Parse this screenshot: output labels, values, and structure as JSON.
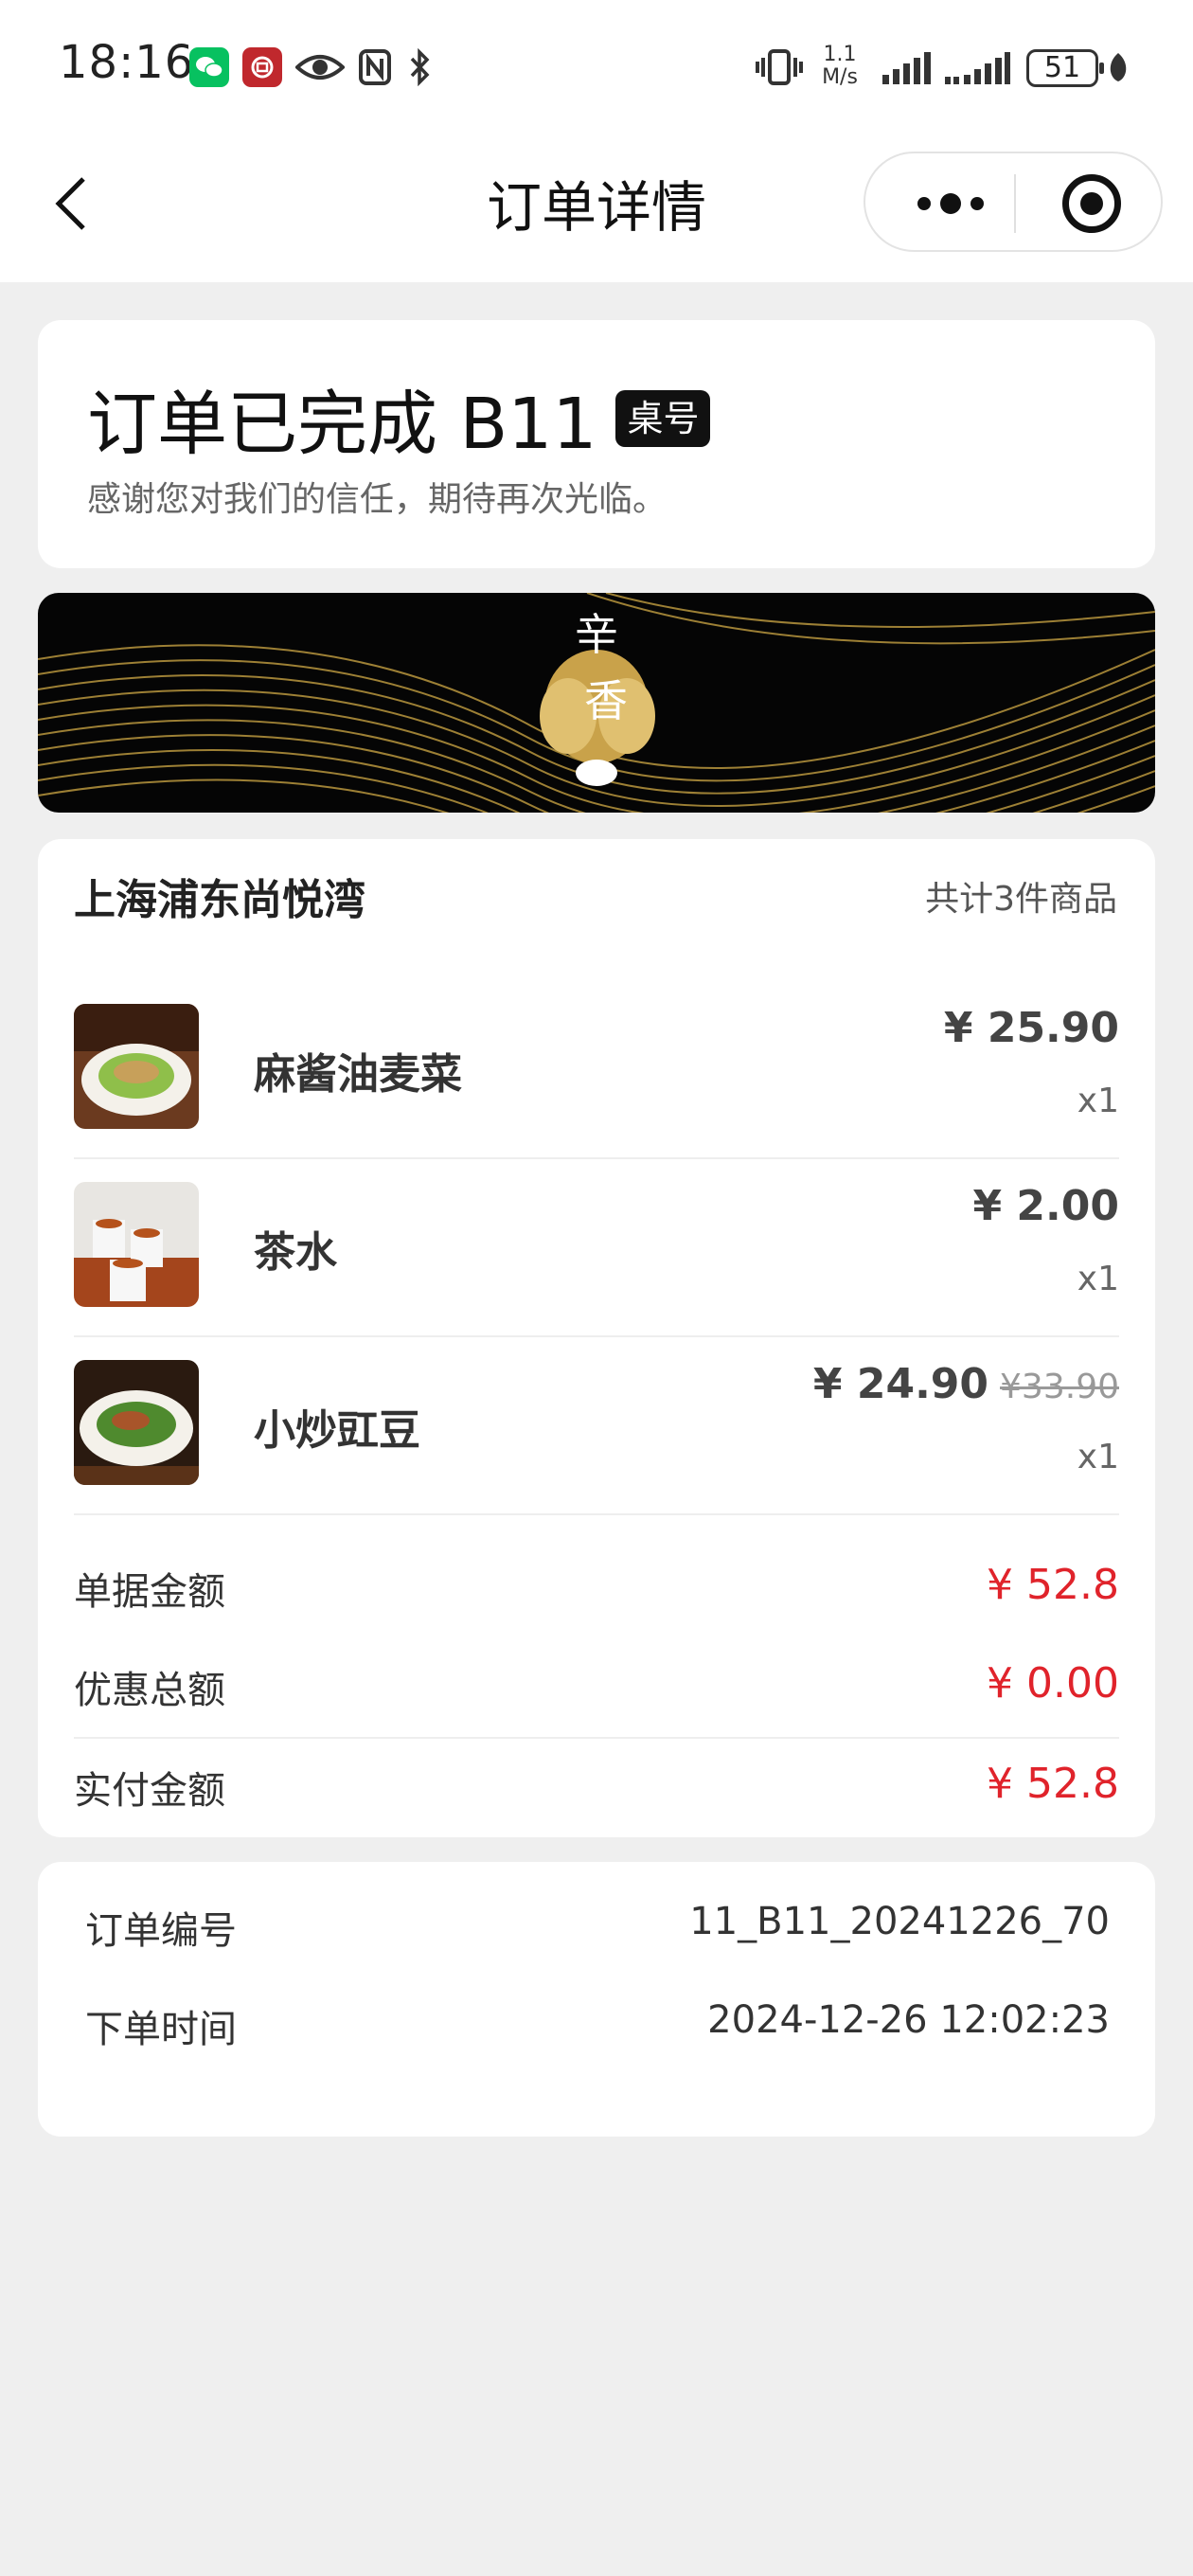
{
  "status_bar": {
    "time": "18:16",
    "speed": "1.1 M/s",
    "battery": "51"
  },
  "nav": {
    "title": "订单详情",
    "icons": [
      "back-arrow-icon",
      "more-dots-icon",
      "record-target-icon"
    ]
  },
  "order_status": {
    "title": "订单已完成 B11",
    "table_badge": "桌号",
    "subtitle": "感谢您对我们的信任，期待再次光临。"
  },
  "banner": {
    "logo_text": "辛香"
  },
  "store": {
    "name": "上海浦东尚悦湾",
    "item_count": "共计3件商品"
  },
  "items": [
    {
      "name": "麻酱油麦菜",
      "price": "¥ 25.90",
      "original_price": "",
      "qty": "x1"
    },
    {
      "name": "茶水",
      "price": "¥ 2.00",
      "original_price": "",
      "qty": "x1"
    },
    {
      "name": "小炒豇豆",
      "price": "¥ 24.90",
      "original_price": "¥33.90",
      "qty": "x1"
    }
  ],
  "summary": {
    "bill_label": "单据金额",
    "bill_value": "¥ 52.8",
    "discount_label": "优惠总额",
    "discount_value": "¥ 0.00",
    "paid_label": "实付金额",
    "paid_value": "¥ 52.8"
  },
  "order_info": {
    "order_no_label": "订单编号",
    "order_no": "11_B11_20241226_70",
    "time_label": "下单时间",
    "time": "2024-12-26 12:02:23"
  },
  "colors": {
    "accent_red": "#e0232b",
    "wechat_green": "#07c160",
    "banner_gold": "#b8963e"
  }
}
